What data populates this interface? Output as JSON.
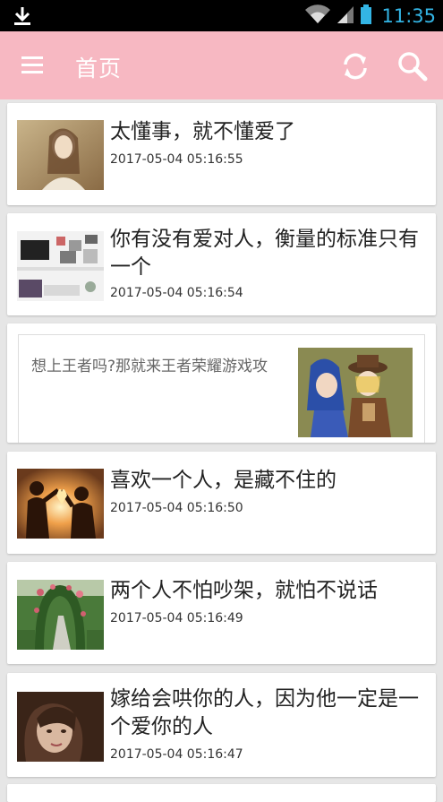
{
  "status_bar": {
    "time": "11:35",
    "icons": [
      "download-icon",
      "wifi-icon",
      "signal-icon",
      "battery-icon"
    ]
  },
  "app_bar": {
    "title": "首页",
    "background_color": "#f7b8c2",
    "icons": [
      "menu-icon",
      "refresh-icon",
      "search-icon"
    ]
  },
  "feed": {
    "items": [
      {
        "type": "article",
        "title": "太懂事，就不懂爱了",
        "time": "2017-05-04 05:16:55",
        "thumb": "woman-portrait-photo"
      },
      {
        "type": "article",
        "title": "你有没有爱对人，衡量的标准只有一个",
        "time": "2017-05-04 05:16:54",
        "thumb": "room-shelf-photo"
      },
      {
        "type": "ad",
        "title": "想上王者吗?那就来王者荣耀游戏攻",
        "thumb": "game-characters-image"
      },
      {
        "type": "article",
        "title": "喜欢一个人，是藏不住的",
        "time": "2017-05-04 05:16:50",
        "thumb": "children-sunset-heart-photo"
      },
      {
        "type": "article",
        "title": "两个人不怕吵架，就怕不说话",
        "time": "2017-05-04 05:16:49",
        "thumb": "garden-arch-photo"
      },
      {
        "type": "article",
        "title": "嫁给会哄你的人，因为他一定是一个爱你的人",
        "time": "2017-05-04 05:16:47",
        "thumb": "girl-portrait-photo"
      }
    ]
  }
}
